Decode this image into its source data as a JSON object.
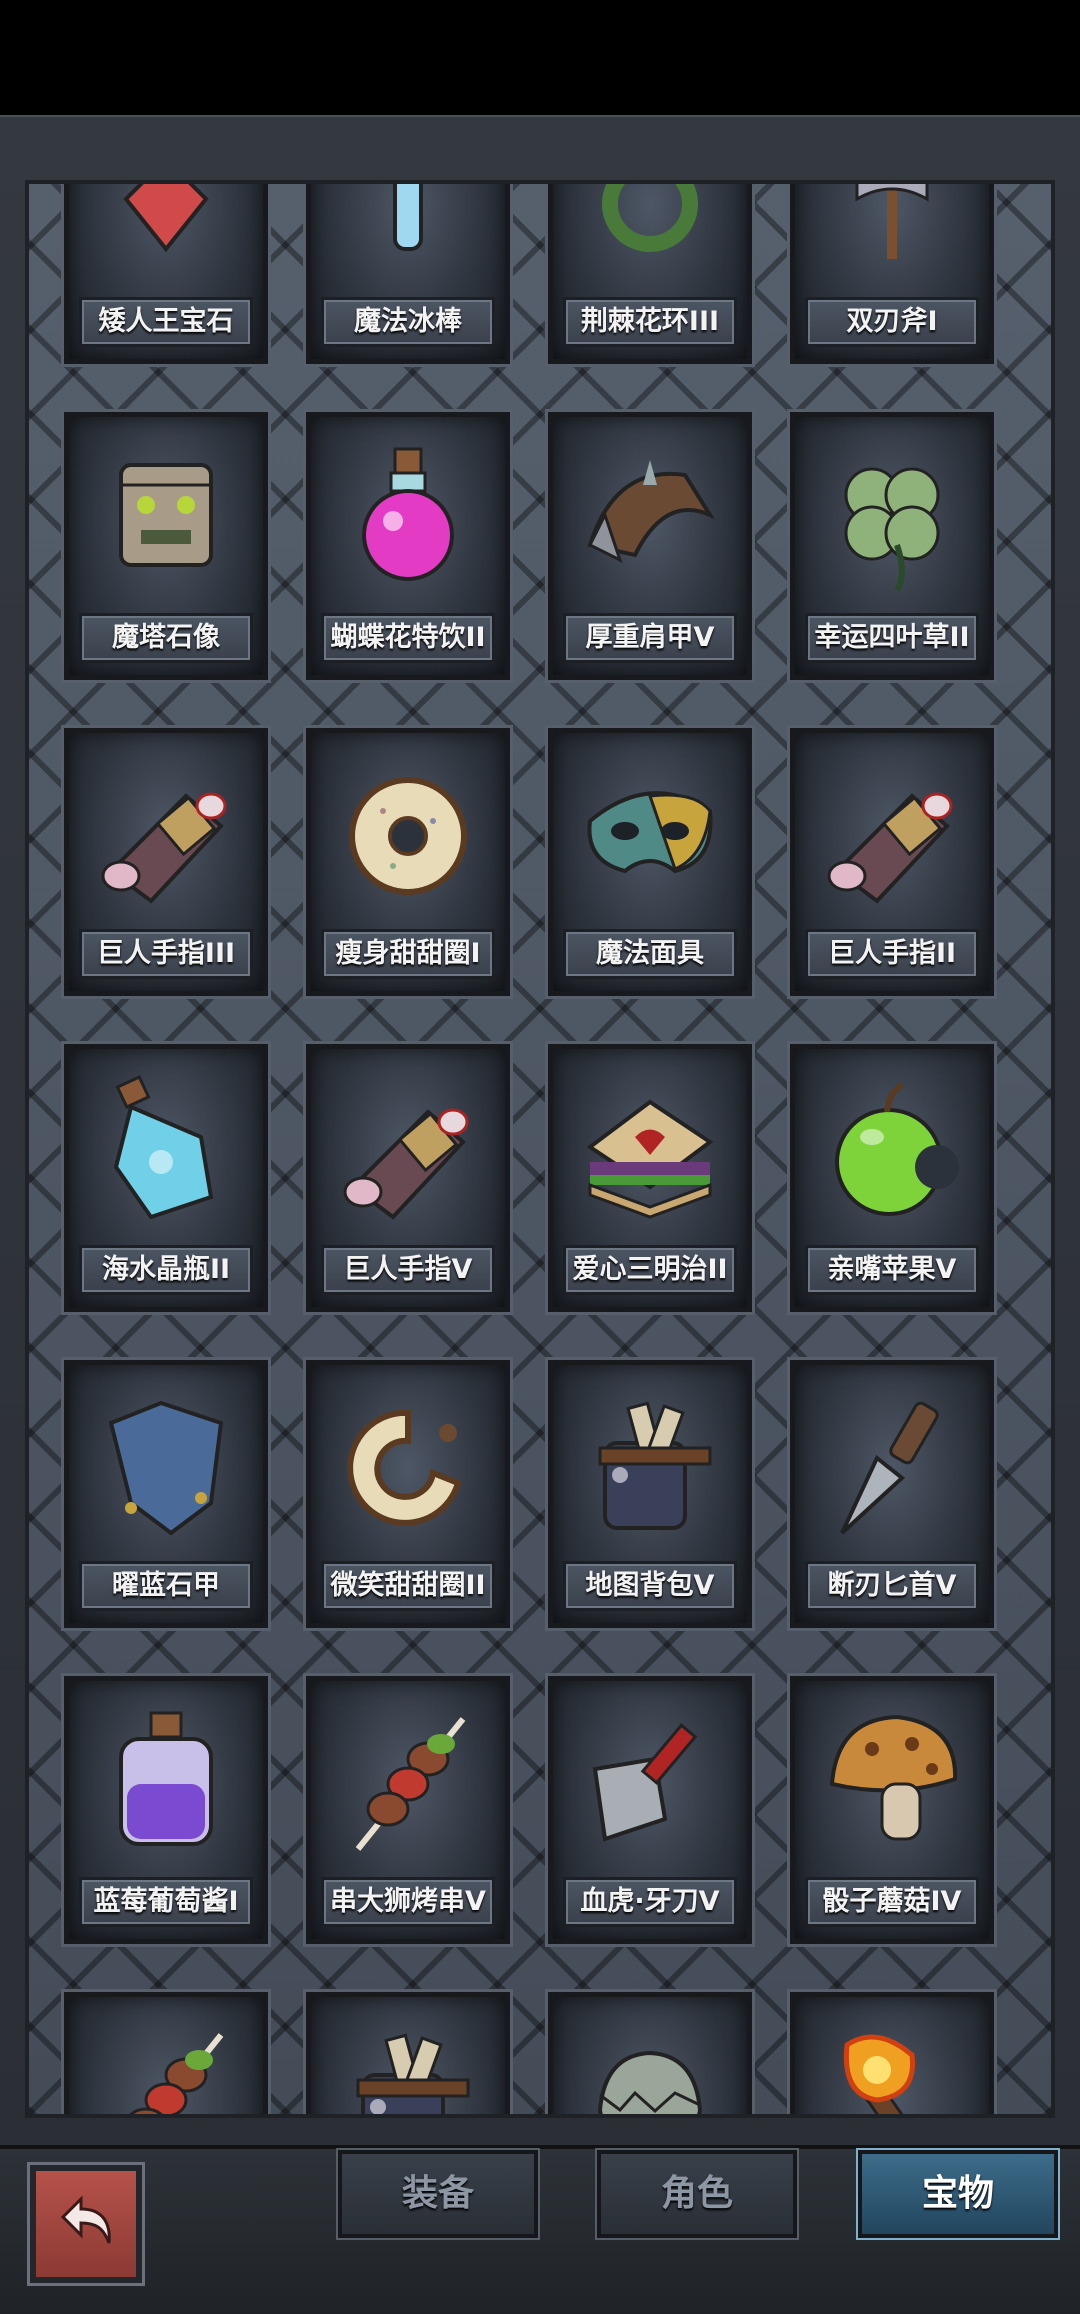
{
  "rows": [
    {
      "items": [
        {
          "name": "矮人王宝石",
          "icon": "gem"
        },
        {
          "name": "魔法冰棒",
          "icon": "ice"
        },
        {
          "name": "荆棘花环III",
          "icon": "wreath"
        },
        {
          "name": "双刃斧I",
          "icon": "axe"
        }
      ]
    },
    {
      "items": [
        {
          "name": "魔塔石像",
          "icon": "totem"
        },
        {
          "name": "蝴蝶花特饮II",
          "icon": "potion-pink"
        },
        {
          "name": "厚重肩甲V",
          "icon": "shoulder"
        },
        {
          "name": "幸运四叶草II",
          "icon": "clover"
        }
      ]
    },
    {
      "items": [
        {
          "name": "巨人手指III",
          "icon": "finger"
        },
        {
          "name": "瘦身甜甜圈I",
          "icon": "donut"
        },
        {
          "name": "魔法面具",
          "icon": "mask"
        },
        {
          "name": "巨人手指II",
          "icon": "finger"
        }
      ]
    },
    {
      "items": [
        {
          "name": "海水晶瓶II",
          "icon": "potion-blue"
        },
        {
          "name": "巨人手指V",
          "icon": "finger"
        },
        {
          "name": "爱心三明治II",
          "icon": "sandwich"
        },
        {
          "name": "亲嘴苹果V",
          "icon": "apple"
        }
      ]
    },
    {
      "items": [
        {
          "name": "曜蓝石甲",
          "icon": "armor"
        },
        {
          "name": "微笑甜甜圈II",
          "icon": "donut-bite"
        },
        {
          "name": "地图背包V",
          "icon": "bag"
        },
        {
          "name": "断刃匕首V",
          "icon": "dagger"
        }
      ]
    },
    {
      "items": [
        {
          "name": "蓝莓葡萄酱I",
          "icon": "potion-purple"
        },
        {
          "name": "串大狮烤串V",
          "icon": "kebab"
        },
        {
          "name": "血虎·牙刀V",
          "icon": "cleaver"
        },
        {
          "name": "骰子蘑菇IV",
          "icon": "mushroom"
        }
      ]
    },
    {
      "items": [
        {
          "name": "",
          "icon": "kebab"
        },
        {
          "name": "",
          "icon": "bag"
        },
        {
          "name": "",
          "icon": "egg"
        },
        {
          "name": "",
          "icon": "torch"
        }
      ]
    }
  ],
  "tabs": {
    "equipment": "装备",
    "character": "角色",
    "treasure": "宝物"
  },
  "active_tab": "treasure",
  "back_icon": "return-arrow-icon"
}
